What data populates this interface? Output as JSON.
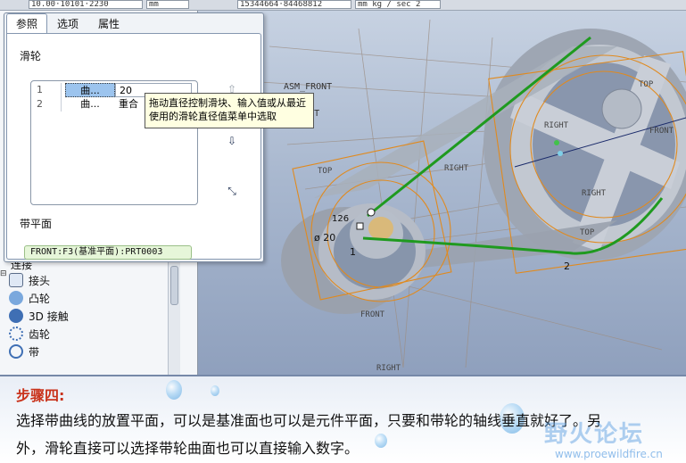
{
  "toolbar": {
    "field1": "10.00·10101·2230",
    "field2": "mm",
    "field3": "15344664·84468812",
    "field4": "mm kg / sec 2"
  },
  "dialog": {
    "tabs": [
      {
        "label": "参照"
      },
      {
        "label": "选项"
      },
      {
        "label": "属性"
      }
    ],
    "pulley_label": "滑轮",
    "pulleys": [
      {
        "num": "1",
        "ref": "曲...",
        "value": "20"
      },
      {
        "num": "2",
        "ref": "曲...",
        "value": "重合"
      }
    ],
    "tooltip": "拖动直径控制滑块、输入值或从最近使用的滑轮直径值菜单中选取",
    "belt_plane_label": "带平面",
    "belt_plane_value": "FRONT:F3(基准平面):PRT0003"
  },
  "tree": {
    "section_label": "连接",
    "items": [
      {
        "label": "接头",
        "icon": "joint-icon"
      },
      {
        "label": "凸轮",
        "icon": "cam-icon"
      },
      {
        "label": "3D 接触",
        "icon": "contact-3d-icon"
      },
      {
        "label": "齿轮",
        "icon": "gear-icon"
      },
      {
        "label": "带",
        "icon": "belt-icon"
      }
    ]
  },
  "viewport": {
    "labels": {
      "asm_front": "ASM_FRONT",
      "right1": "RIGHT",
      "front1": "FRONT",
      "top1": "TOP",
      "right2": "RIGHT",
      "top2": "TOP",
      "front2": "FRONT",
      "right3": "RIGHT",
      "top3": "TOP",
      "right4": "RIGHT",
      "front3": "FRONT",
      "dim_dia": "ø 20",
      "dim_1": "1",
      "dim_2": "2",
      "dim_126": "126"
    },
    "colors": {
      "belt": "#1f9a1f",
      "datum": "#e08a1f",
      "wheel": "#b9bfc9"
    }
  },
  "caption": {
    "step": "步骤四:",
    "line1": "选择带曲线的放置平面，可以是基准面也可以是元件平面，只要和带轮的轴线垂直就好了。另",
    "line2": "外，滑轮直接可以选择带轮曲面也可以直接输入数字。",
    "watermark": "野火论坛",
    "watermark_url": "www.proewildfire.cn"
  }
}
